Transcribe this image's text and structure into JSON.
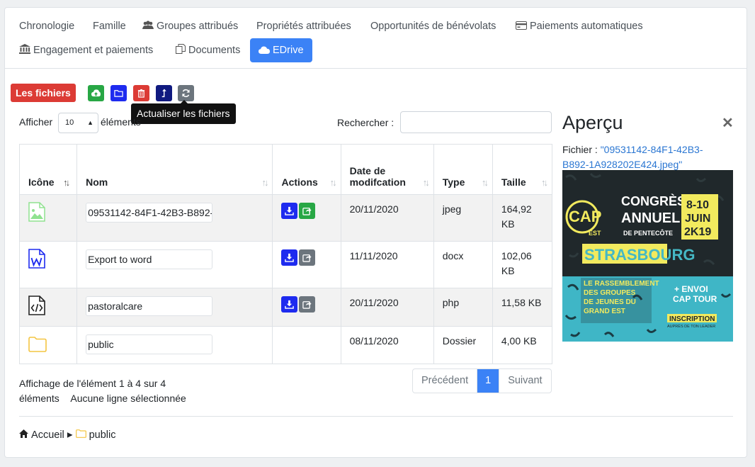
{
  "tabs": [
    {
      "label": "Chronologie",
      "icon": ""
    },
    {
      "label": "Famille",
      "icon": ""
    },
    {
      "label": "Groupes attribués",
      "icon": "users-icon"
    },
    {
      "label": "Propriétés attribuées",
      "icon": ""
    },
    {
      "label": "Opportunités de bénévolats",
      "icon": ""
    },
    {
      "label": "Paiements automatiques",
      "icon": "credit-card-icon"
    },
    {
      "label": "Engagement et paiements",
      "icon": "bank-icon"
    },
    {
      "label": "Documents",
      "icon": "copy-icon"
    },
    {
      "label": "EDrive",
      "icon": "cloud-icon",
      "active": true
    }
  ],
  "files_badge": "Les fichiers",
  "toolbar": {
    "tooltip": "Actualiser les fichiers",
    "colors": {
      "upload": "#28a745",
      "folder": "#1e2bef",
      "delete": "#dc3b35",
      "up": "#101a80",
      "refresh": "#6c757d"
    }
  },
  "datatable": {
    "show_label": "Afficher",
    "length_value": "10",
    "elements_label": "éléments",
    "search_label": "Rechercher :",
    "search_value": "",
    "columns": [
      "Icône",
      "Nom",
      "Actions",
      "Date de modifcation",
      "Type",
      "Taille"
    ],
    "rows": [
      {
        "icon": "image-file-icon",
        "name": "09531142-84F1-42B3-B892-1A928202E424.jpeg",
        "date": "20/11/2020",
        "type": "jpeg",
        "size": "164,92 KB",
        "has_actions": true,
        "share_color": "#28a745"
      },
      {
        "icon": "word-file-icon",
        "name": "Export to word",
        "date": "11/11/2020",
        "type": "docx",
        "size": "102,06 KB",
        "has_actions": true,
        "share_color": "#6c757d"
      },
      {
        "icon": "code-file-icon",
        "name": "pastoralcare",
        "date": "20/11/2020",
        "type": "php",
        "size": "11,58 KB",
        "has_actions": true,
        "share_color": "#6c757d"
      },
      {
        "icon": "folder-icon",
        "name": "public",
        "date": "08/11/2020",
        "type": "Dossier",
        "size": "4,00 KB",
        "has_actions": false
      }
    ],
    "info_line1": "Affichage de l'élément 1 à 4 sur 4",
    "info_line2_a": "éléments",
    "info_line2_b": "Aucune ligne sélectionnée",
    "pager": {
      "prev": "Précédent",
      "current": "1",
      "next": "Suivant"
    }
  },
  "breadcrumb": {
    "home": "Accueil",
    "folder": "public"
  },
  "preview": {
    "title": "Aperçu",
    "file_label": "Fichier :",
    "file_name": "\"09531142-84F1-42B3-B892-1A928202E424.jpeg\"",
    "poster": {
      "logo_cap": "CAP",
      "logo_est": "EST",
      "line1": "CONGRÈS",
      "line2": "ANNUEL",
      "line3": "DE PENTECÔTE",
      "dates1": "8-10",
      "dates2": "JUIN",
      "dates3": "2K19",
      "city": "STRASBOURG",
      "tag1": "LE RASSEMBLEMENT",
      "tag2": "DES GROUPES",
      "tag3": "DE JEUNES DU",
      "tag4": "GRAND EST",
      "envoi1": "+ ENVOI",
      "envoi2": "CAP TOUR",
      "inscription": "INSCRIPTION",
      "aupres": "AUPRÈS DE TON LEADER"
    }
  }
}
